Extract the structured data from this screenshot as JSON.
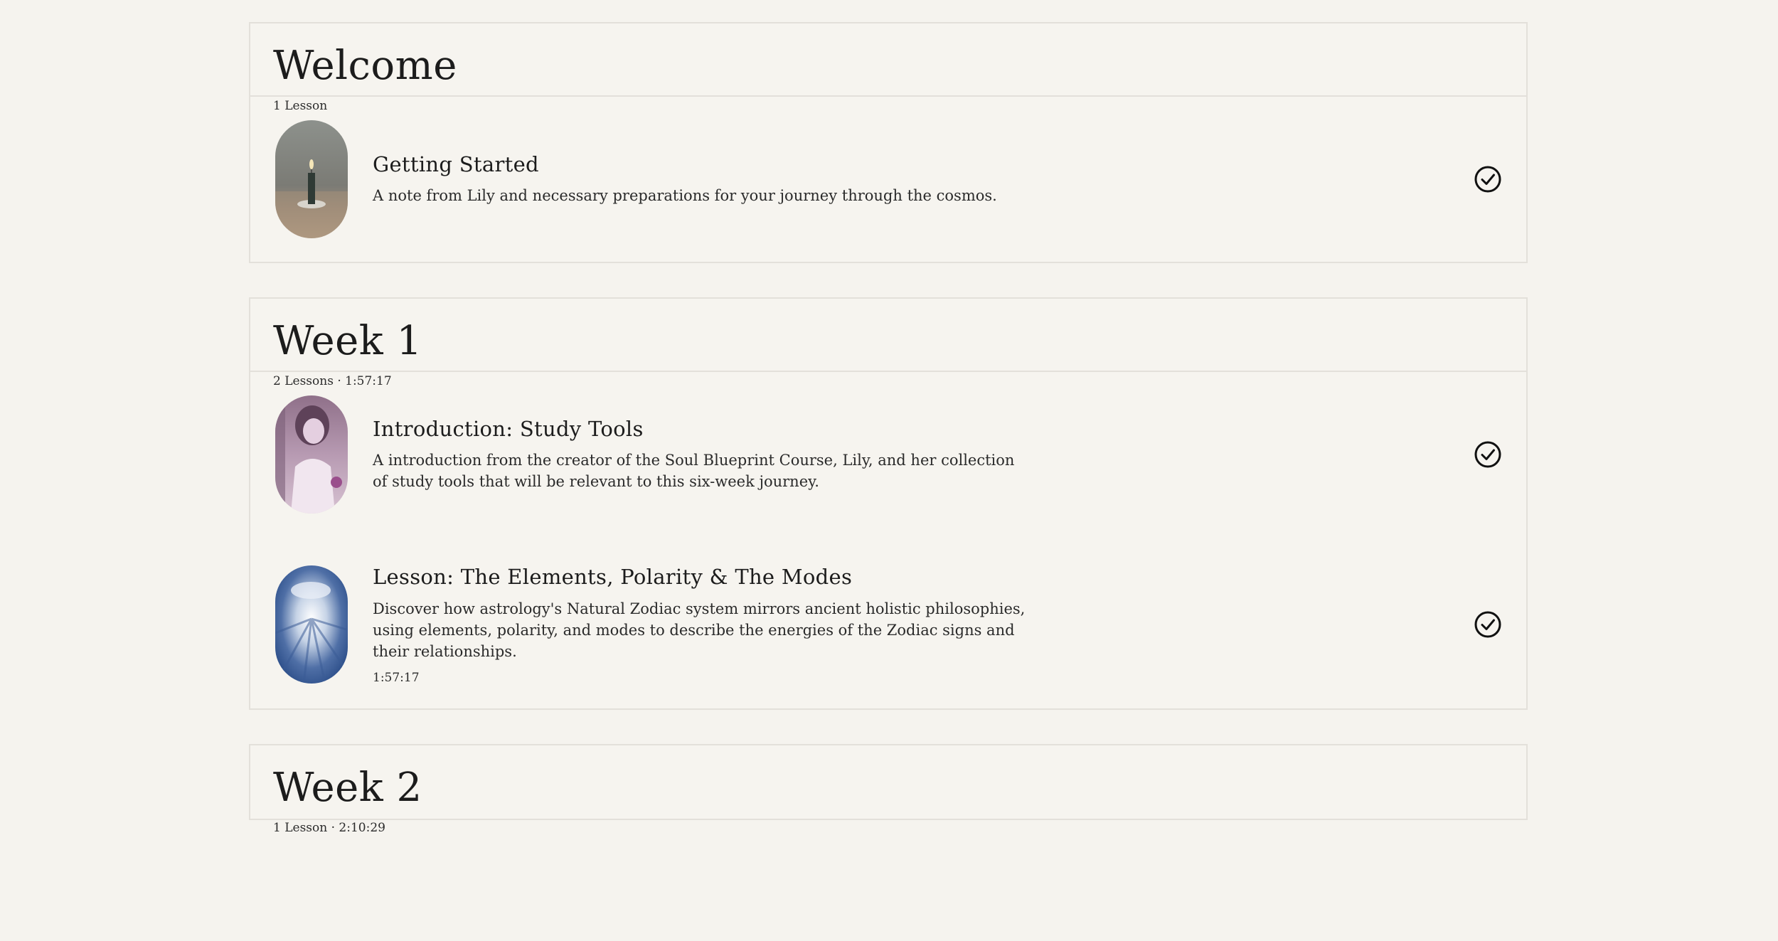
{
  "sections": [
    {
      "title": "Welcome",
      "meta": "1 Lesson",
      "lessons": [
        {
          "title": "Getting Started",
          "description": "A note from Lily and necessary preparations for your journey through the cosmos.",
          "icon": "check-circle-icon"
        }
      ]
    },
    {
      "title": "Week 1",
      "meta": "2 Lessons · 1:57:17",
      "lessons": [
        {
          "title": "Introduction: Study Tools",
          "description": "A introduction from the creator of the Soul Blueprint Course, Lily, and her collection of study tools that will be relevant to this six-week journey.",
          "icon": "check-circle-icon"
        },
        {
          "title": "Lesson: The Elements, Polarity & The Modes",
          "description": "Discover how astrology's Natural Zodiac system mirrors ancient holistic philosophies, using elements, polarity, and modes to describe the energies of the Zodiac signs and their relationships.",
          "duration": "1:57:17",
          "icon": "check-circle-icon"
        }
      ]
    },
    {
      "title": "Week 2",
      "meta": "1 Lesson · 2:10:29"
    }
  ],
  "colors": {
    "background": "#f5f3ee",
    "border": "#e3e0da",
    "text": "#1c1c1c"
  }
}
